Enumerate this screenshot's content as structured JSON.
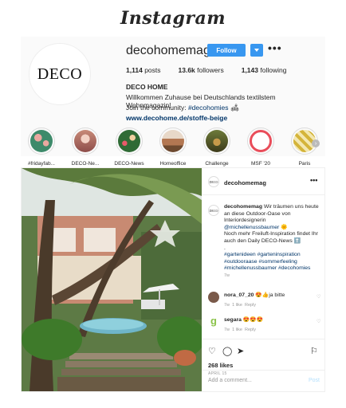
{
  "app": {
    "logo": "Instagram"
  },
  "profile": {
    "avatar_text": "DECO",
    "username": "decohomemag",
    "follow_label": "Follow",
    "more_label": "•••",
    "stats": {
      "posts_count": "1,114",
      "posts_label": "posts",
      "followers_count": "13.6k",
      "followers_label": "followers",
      "following_count": "1,143",
      "following_label": "following"
    },
    "bio_name": "DECO HOME",
    "bio_line1": "Willkommen Zuhause bei Deutschlands textilstem Wohnmagazin!",
    "bio_line2_prefix": "Join the community: ",
    "bio_line2_tag": "#decohomies",
    "bio_line2_emoji": "🛋",
    "bio_link": "www.decohome.de/stoffe-beige"
  },
  "highlights": [
    {
      "label": "#fridayfab...",
      "color": "#3d8a6a"
    },
    {
      "label": "DECO-Ne...",
      "color": "#c88a78"
    },
    {
      "label": "DECO-News",
      "color": "#2f6b35"
    },
    {
      "label": "Homeoffice",
      "color": "#b37752"
    },
    {
      "label": "Challenge",
      "color": "#8a6a2a"
    },
    {
      "label": "MSF '20",
      "color": "#e94d5a"
    },
    {
      "label": "Paris",
      "color": "#d4b43a"
    }
  ],
  "highlights_arrow": "›",
  "post": {
    "header_username": "decohomemag",
    "more_label": "•••",
    "avatar_text": "DECO",
    "caption_username": "decohomemag",
    "caption_l1": "Wir träumen uns heute an diese Outdoor-Oase von Interiordesignerin",
    "caption_mention": "@michellenussbaumer",
    "caption_emoji1": "🌞",
    "caption_l2": "Noch mehr Freiluft-Inspiration findet Ihr auch den Daily DECO-News ⬆️",
    "caption_dot": ".",
    "caption_tags": "#gartenideen #garteninspiration #outdooraase #sommerfeeling #michellenussbaumer #decohomies",
    "caption_time": "7w",
    "comments": [
      {
        "user": "nora_07_20",
        "text": "😍👍ja bitte",
        "age": "7w",
        "likes": "1 like",
        "reply": "Reply",
        "avatar_color": "#7a5a4a"
      },
      {
        "user": "segara",
        "text": "😍😍😍",
        "age": "7w",
        "likes": "1 like",
        "reply": "Reply",
        "avatar_color": "#ffffff"
      }
    ],
    "segara_glyph": "g",
    "likes": "268 likes",
    "date": "APRIL 15",
    "add_comment_placeholder": "Add a comment...",
    "post_label": "Post"
  }
}
